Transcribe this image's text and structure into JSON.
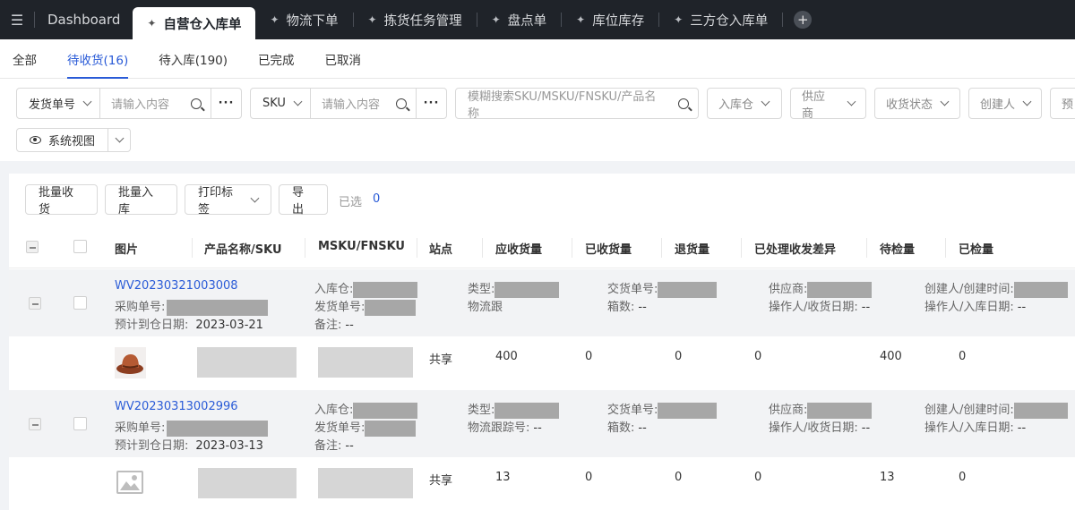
{
  "tabs": {
    "dashboard": "Dashboard",
    "items": [
      "自营仓入库单",
      "物流下单",
      "拣货任务管理",
      "盘点单",
      "库位库存",
      "三方仓入库单"
    ]
  },
  "status_tabs": [
    "全部",
    "待收货(16)",
    "待入库(190)",
    "已完成",
    "已取消"
  ],
  "filters": {
    "g1_select": "发货单号",
    "g1_placeholder": "请输入内容",
    "g2_select": "SKU",
    "g2_placeholder": "请输入内容",
    "fuzzy_placeholder": "模糊搜索SKU/MSKU/FNSKU/产品名称",
    "dropdowns": [
      "入库仓",
      "供应商",
      "收货状态",
      "创建人",
      "预"
    ],
    "view": "系统视图"
  },
  "toolbar": {
    "batch_receive": "批量收货",
    "batch_instock": "批量入库",
    "print_label": "打印标签",
    "export": "导出",
    "selected_label": "已选",
    "selected_count": "0"
  },
  "columns": [
    "图片",
    "产品名称/SKU",
    "MSKU/FNSKU",
    "站点",
    "应收货量",
    "已收货量",
    "退货量",
    "已处理收发差异",
    "待检量",
    "已检量"
  ],
  "labels": {
    "purchase_no": "采购单号:",
    "eta": "预计到仓日期:",
    "warehouse": "入库仓:",
    "ship_no": "发货单号:",
    "remark": "备注:",
    "type": "类型:",
    "delivery_no": "交货单号:",
    "box_count": "箱数:",
    "supplier": "供应商:",
    "operator": "操作人/收货日期:",
    "creator": "创建人/创建时间:",
    "creator2": "操作人/入库日期:"
  },
  "rows": [
    {
      "order_no": "WV20230321003008",
      "eta_date": "2023-03-21",
      "remark_val": "--",
      "logistics": "物流跟",
      "box_val": "--",
      "operator_val": "--",
      "creator2_val": "--",
      "site": "共享",
      "expected": "400",
      "received": "0",
      "returned": "0",
      "diff": "0",
      "pending": "400",
      "checked": "0"
    },
    {
      "order_no": "WV20230313002996",
      "eta_date": "2023-03-13",
      "remark_val": "--",
      "logistics": "物流跟踪号:",
      "logistics_val": "--",
      "box_val": "--",
      "operator_val": "--",
      "creator2_val": "--",
      "site": "共享",
      "expected": "13",
      "received": "0",
      "returned": "0",
      "diff": "0",
      "pending": "13",
      "checked": "0"
    }
  ]
}
